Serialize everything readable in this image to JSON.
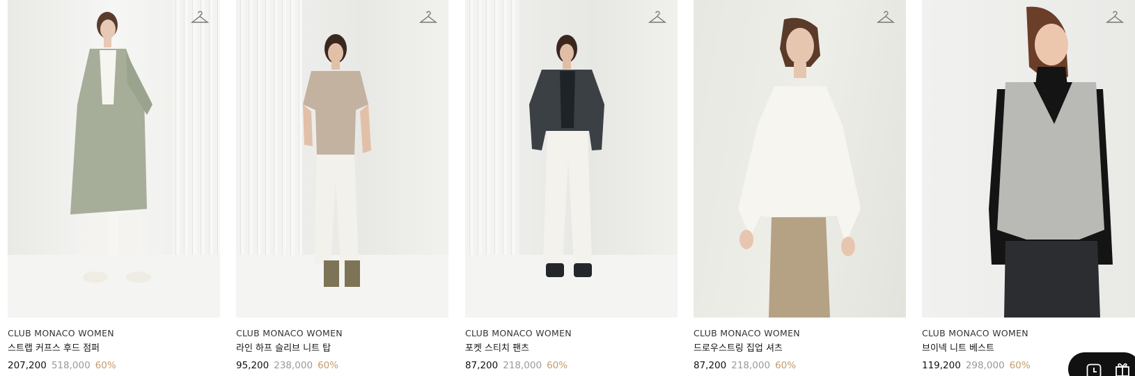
{
  "products": [
    {
      "brand": "CLUB MONACO WOMEN",
      "name": "스트랩 커프스 후드 점퍼",
      "sale_price": "207,200",
      "original_price": "518,000",
      "discount": "60%",
      "image_alt": "model wearing sage green hooded trench coat",
      "icon": "hanger-icon"
    },
    {
      "brand": "CLUB MONACO WOMEN",
      "name": "라인 하프 슬리브 니트 탑",
      "sale_price": "95,200",
      "original_price": "238,000",
      "discount": "60%",
      "image_alt": "model wearing beige half sleeve knit top",
      "icon": "hanger-icon"
    },
    {
      "brand": "CLUB MONACO WOMEN",
      "name": "포켓 스티치 팬츠",
      "sale_price": "87,200",
      "original_price": "218,000",
      "discount": "60%",
      "image_alt": "model wearing leather jacket and white pants",
      "icon": "hanger-icon"
    },
    {
      "brand": "CLUB MONACO WOMEN",
      "name": "드로우스트링 집업 셔츠",
      "sale_price": "87,200",
      "original_price": "218,000",
      "discount": "60%",
      "image_alt": "model wearing white drawstring blouse",
      "icon": "hanger-icon"
    },
    {
      "brand": "CLUB MONACO WOMEN",
      "name": "브이넥 니트 베스트",
      "sale_price": "119,200",
      "original_price": "298,000",
      "discount": "60%",
      "image_alt": "model wearing grey v-neck knit vest",
      "icon": "hanger-icon"
    }
  ],
  "floating_widget": {
    "icons": [
      "clock-icon",
      "gift-icon"
    ]
  },
  "colors": {
    "discount": "#c49a6c",
    "original_price": "#9a9a9a",
    "widget_bg": "#111111"
  }
}
